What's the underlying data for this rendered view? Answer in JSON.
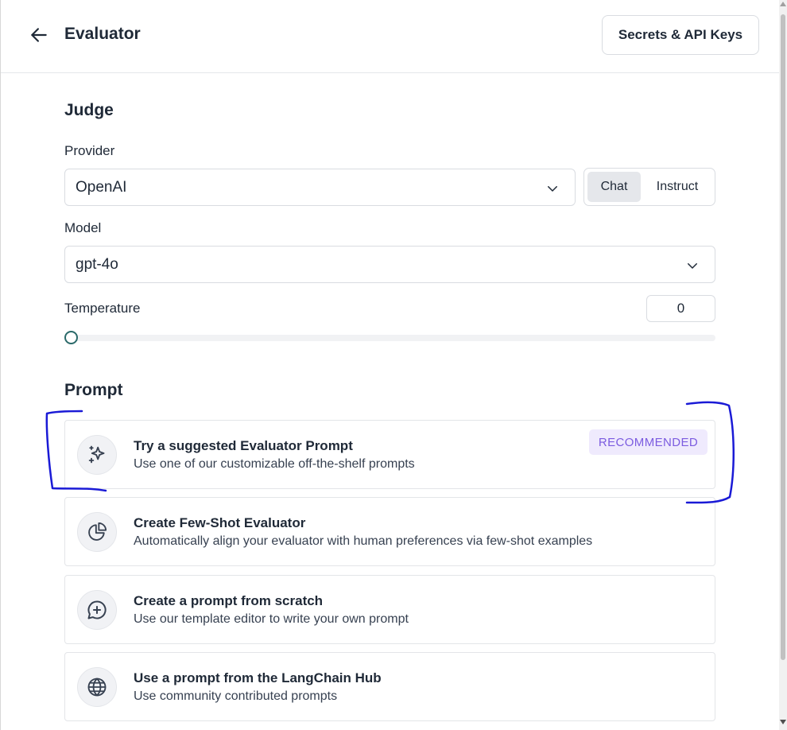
{
  "header": {
    "title": "Evaluator",
    "secrets_button": "Secrets & API Keys"
  },
  "judge": {
    "section_title": "Judge",
    "provider": {
      "label": "Provider",
      "value": "OpenAI",
      "modes": [
        {
          "label": "Chat",
          "active": true
        },
        {
          "label": "Instruct",
          "active": false
        }
      ]
    },
    "model": {
      "label": "Model",
      "value": "gpt-4o"
    },
    "temperature": {
      "label": "Temperature",
      "value": "0",
      "slider_fraction": 0
    }
  },
  "prompt": {
    "section_title": "Prompt",
    "options": [
      {
        "title": "Try a suggested Evaluator Prompt",
        "description": "Use one of our customizable off-the-shelf prompts",
        "badge": "RECOMMENDED",
        "icon": "sparkles-icon"
      },
      {
        "title": "Create Few-Shot Evaluator",
        "description": "Automatically align your evaluator with human preferences via few-shot examples",
        "icon": "pie-chart-icon"
      },
      {
        "title": "Create a prompt from scratch",
        "description": "Use our template editor to write your own prompt",
        "icon": "message-plus-icon"
      },
      {
        "title": "Use a prompt from the LangChain Hub",
        "description": "Use community contributed prompts",
        "icon": "globe-icon"
      }
    ]
  },
  "colors": {
    "badge_bg": "#efeafd",
    "badge_text": "#7c5ce0",
    "slider_thumb": "#2b6a6a",
    "annotation_ink": "#1a1ad6"
  }
}
